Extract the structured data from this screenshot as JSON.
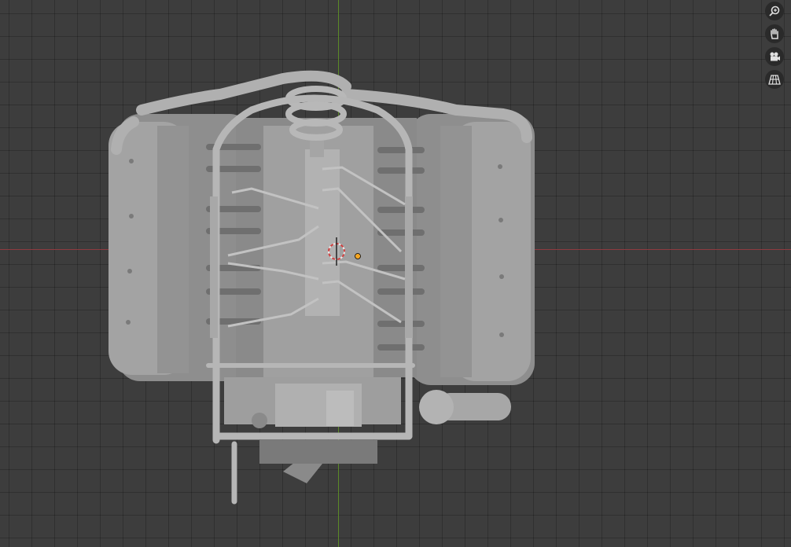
{
  "viewport": {
    "background_color": "#3d3d3d",
    "x_axis_color": "#8e3a40",
    "y_axis_color": "#5b8a28",
    "model_color": "#9a9a9a"
  },
  "navigation_gizmo": {
    "buttons": [
      {
        "icon": "zoom-icon"
      },
      {
        "icon": "hand-pan-icon"
      },
      {
        "icon": "camera-icon"
      },
      {
        "icon": "perspective-grid-icon"
      }
    ]
  }
}
